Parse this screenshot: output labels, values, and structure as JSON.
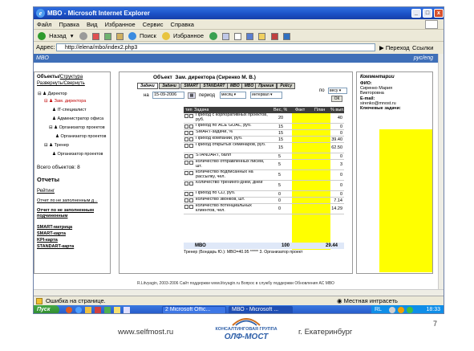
{
  "window": {
    "title": "МВО - Microsoft Internet Explorer",
    "min_label": "_",
    "max_label": "□",
    "close_label": "x"
  },
  "menu": [
    "Файл",
    "Правка",
    "Вид",
    "Избранное",
    "Сервис",
    "Справка"
  ],
  "toolbar": {
    "back_label": "Назад",
    "search_label": "Поиск",
    "favorites_label": "Избранное"
  },
  "address": {
    "label": "Адрес:",
    "url": "http://elena/mbo/index2.php3",
    "go_label": "Переход",
    "links_label": "Ссылки"
  },
  "site": {
    "header_left": "МВО",
    "header_right": "рус/eng"
  },
  "sidebar": {
    "objects_label": "Объекты/",
    "structure_link": "Структура",
    "collapse_link": "Развернуть",
    "expand_link": "Свернуть",
    "tree": [
      "Директор",
      "Зам. директора",
      "IT-специалист",
      "Администратор офиса",
      "Организатор проектов",
      "Организатор проектов",
      "Тренер",
      "Организатор проектов"
    ],
    "total_label": "Всего объектов: 8",
    "reports_title": "Отчеты",
    "rating_link": "Рейтинг",
    "not_filled_link": "Отчет по не заполненным д...",
    "not_filled_bold_1": "Отчет по не заполненным",
    "not_filled_bold_2": "подчиненным",
    "smart_matrix": "SMART-матрица",
    "smart_card": "SMART-карта",
    "kpi_card": "KPI-карта",
    "standart_card": "STANDART-карта"
  },
  "center": {
    "object_label": "Объект",
    "object_value": "Зам. директора (Сиренко М. В.)",
    "tabs": [
      "Задачи",
      "Задачи",
      "SMART",
      "STANDART",
      "MBO",
      "MBO",
      "Премия",
      "Policy"
    ],
    "date_prefix": "на",
    "date_value": "15-09-2006",
    "period_label": "период",
    "period_value": "месяц",
    "interval_value": "интервал",
    "by_label": "по",
    "by_value": "весу",
    "ok_label": "ОК",
    "columns": [
      "тип",
      "Задача",
      "Вес, %",
      "Факт",
      "План",
      "% вып."
    ],
    "rows": [
      {
        "task": "Приход с корпоративных проектов, руб.",
        "weight": "20",
        "fact": "",
        "plan": "",
        "pct": "40"
      },
      {
        "task": "Приход по ACE GOAL, руб.",
        "weight": "15",
        "fact": "",
        "plan": "",
        "pct": "0"
      },
      {
        "task": "SMART-задачи, %",
        "weight": "15",
        "fact": "",
        "plan": "",
        "pct": "0"
      },
      {
        "task": "Приход компании, руб.",
        "weight": "15",
        "fact": "",
        "plan": "",
        "pct": "39.40"
      },
      {
        "task": "Приход открытых семинаров, руб.",
        "weight": "15",
        "fact": "",
        "plan": "",
        "pct": "62.50"
      },
      {
        "task": "STANDART, балл",
        "weight": "5",
        "fact": "",
        "plan": "",
        "pct": "0"
      },
      {
        "task": "количество отправленных писем, шт.",
        "weight": "5",
        "fact": "",
        "plan": "",
        "pct": "3"
      },
      {
        "task": "количество подписанных на рассылку, чел.",
        "weight": "5",
        "fact": "",
        "plan": "",
        "pct": "0"
      },
      {
        "task": "Количество тренинго-дней, дней",
        "weight": "5",
        "fact": "",
        "plan": "",
        "pct": "0"
      },
      {
        "task": "Приход по CD, руб.",
        "weight": "0",
        "fact": "",
        "plan": "",
        "pct": "0"
      },
      {
        "task": "количество звонков, шт.",
        "weight": "0",
        "fact": "",
        "plan": "",
        "pct": "7.14"
      },
      {
        "task": "количество потенциальных клиентов, чел.",
        "weight": "0",
        "fact": "",
        "plan": "",
        "pct": "14.29"
      }
    ],
    "total_row": {
      "task": "МВО",
      "weight": "100",
      "pct": "29.44"
    },
    "summary": "Тренер (Бондарь Ю.): МВО=40.95 ***** 3. Организатор проект"
  },
  "comments": {
    "title": "Комментарии",
    "fio_label": "ФИО:",
    "fio_value": "Сиренко Мария Викторовна",
    "email_label": "E-mail:",
    "email_value": "sirenko@mnost.ru",
    "key_tasks_label": "Ключевые задачи:"
  },
  "page_footer": "R.Litvyagin, 2003-2006   Сайт поддержки www.litvyagin.ru   Вопрос в службу поддержки   Обновления АС МВО",
  "status": {
    "left": "Ошибка на странице.",
    "right": "Местная интрасеть"
  },
  "taskbar": {
    "start_label": "Пуск",
    "task1": "2 Microsoft Offic...",
    "task2": "МВО - Microsoft ...",
    "clock": "18:33",
    "lang": "RL"
  },
  "slide": {
    "url": "www.selfmost.ru",
    "logo_top": "КОНСАЛТИНГОВАЯ ГРУППА",
    "logo_bottom": "ОЛФ-МОСТ",
    "city": "г. Екатеринбург",
    "page_number": "7"
  },
  "colors": {
    "highlight": "#ffff00",
    "xp_blue": "#2457c8",
    "header_blue": "#3f6fb8"
  }
}
